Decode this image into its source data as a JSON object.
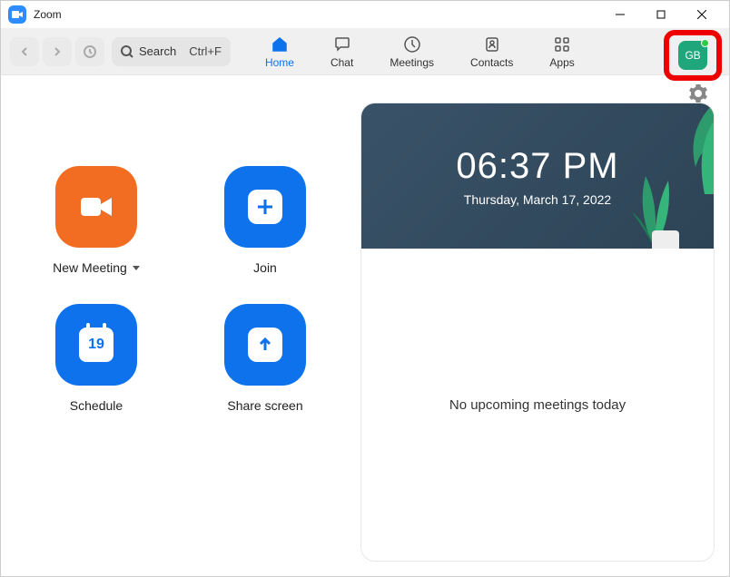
{
  "titlebar": {
    "title": "Zoom"
  },
  "search": {
    "label": "Search",
    "shortcut": "Ctrl+F"
  },
  "nav": {
    "home": "Home",
    "chat": "Chat",
    "meetings": "Meetings",
    "contacts": "Contacts",
    "apps": "Apps"
  },
  "profile": {
    "initials": "GB"
  },
  "actions": {
    "new_meeting": "New Meeting",
    "join": "Join",
    "schedule": "Schedule",
    "share": "Share screen",
    "calendar_day": "19"
  },
  "clock": {
    "time": "06:37 PM",
    "date": "Thursday, March 17, 2022"
  },
  "meetings_panel": {
    "empty_message": "No upcoming meetings today"
  }
}
